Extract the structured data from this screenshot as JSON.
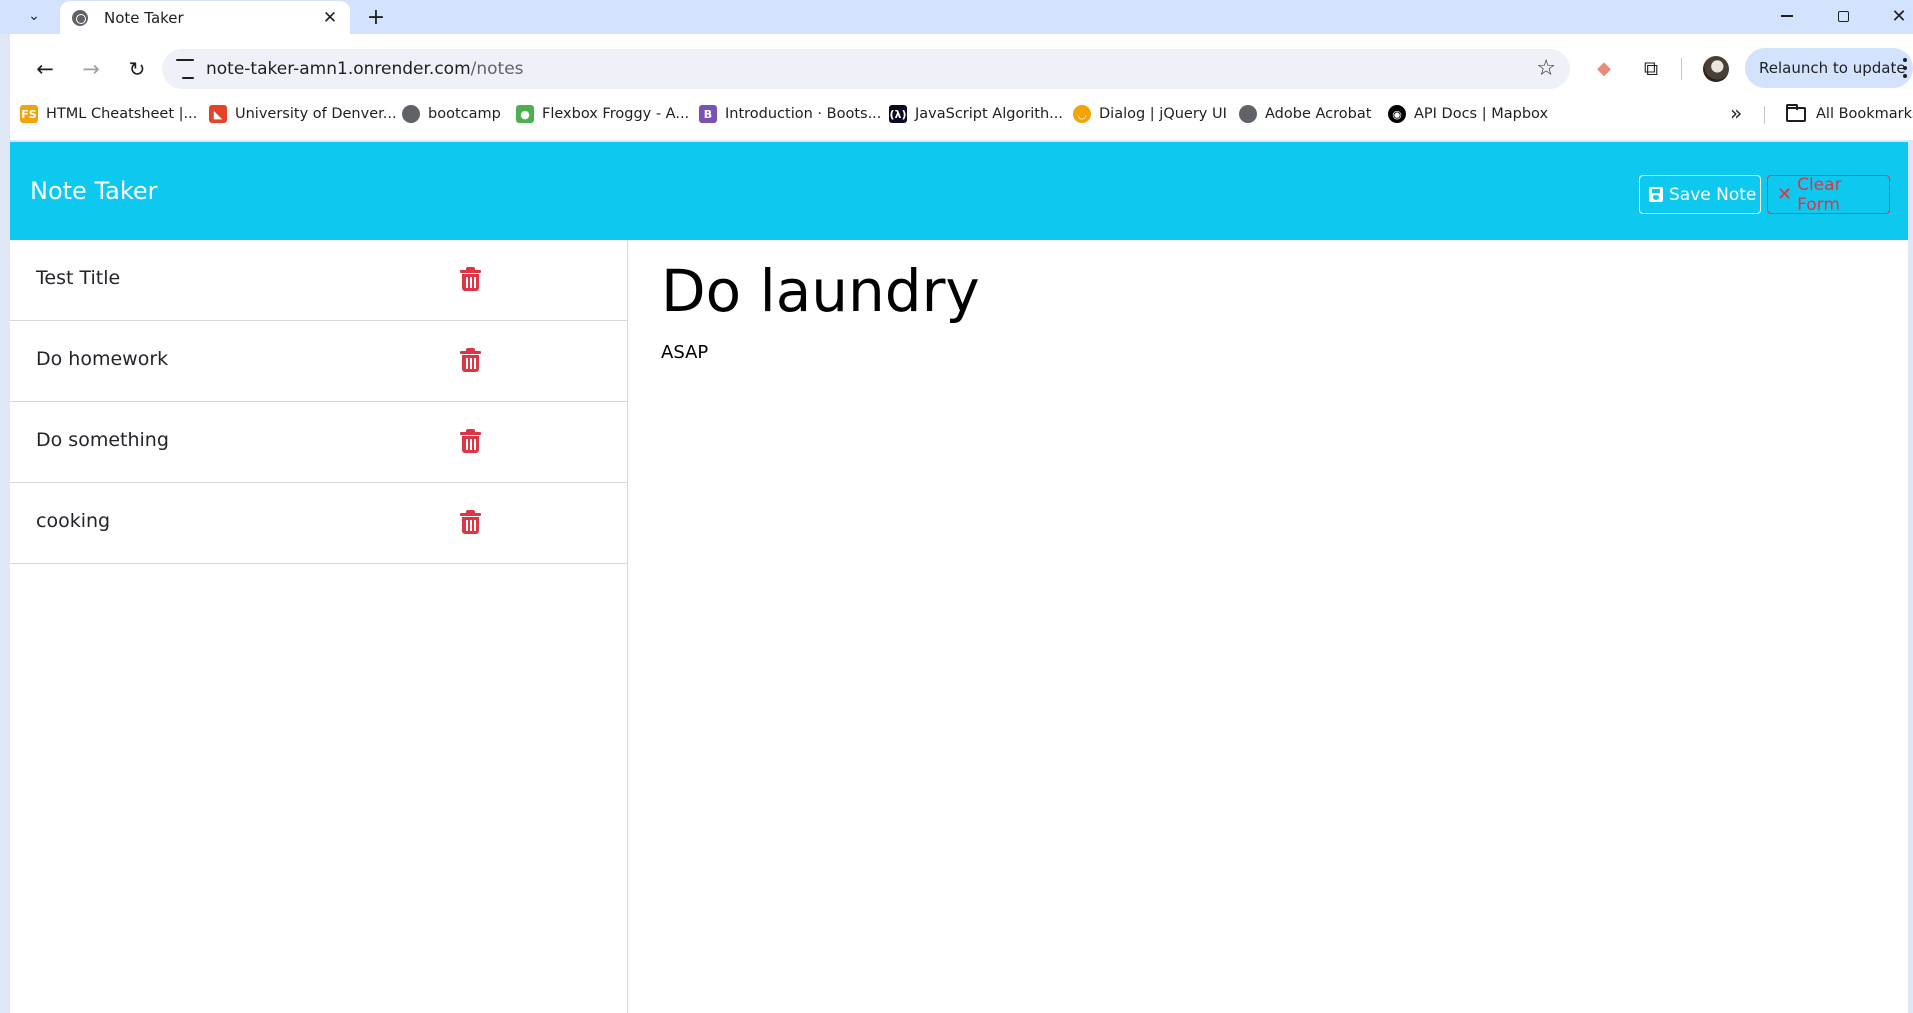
{
  "browser": {
    "tab": {
      "title": "Note Taker",
      "close_glyph": "✕"
    },
    "new_tab_glyph": "+",
    "window_close_glyph": "✕",
    "address": {
      "host": "note-taker-amn1.onrender.com",
      "path": "/notes"
    },
    "relaunch_label": "Relaunch to update",
    "bookmarks": [
      {
        "label": "HTML Cheatsheet |...",
        "icon": "fs-icon",
        "color": "#f0a30a"
      },
      {
        "label": "University of Denver...",
        "icon": "gitlab-icon",
        "color": "#e24329"
      },
      {
        "label": "bootcamp",
        "icon": "globe-icon",
        "color": "#5f6368"
      },
      {
        "label": "Flexbox Froggy - A...",
        "icon": "frog-icon",
        "color": "#4caf50"
      },
      {
        "label": "Introduction · Boots...",
        "icon": "bootstrap-icon",
        "color": "#7952b3"
      },
      {
        "label": "JavaScript Algorith...",
        "icon": "fcc-icon",
        "color": "#0a0a23"
      },
      {
        "label": "Dialog | jQuery UI",
        "icon": "jquery-icon",
        "color": "#f4a300"
      },
      {
        "label": "Adobe Acrobat",
        "icon": "globe-icon",
        "color": "#5f6368"
      },
      {
        "label": "API Docs | Mapbox",
        "icon": "mapbox-icon",
        "color": "#000000"
      }
    ],
    "all_bookmarks_label": "All Bookmarks"
  },
  "app": {
    "brand": "Note Taker",
    "save_label": "Save Note",
    "clear_label": "Clear Form",
    "notes": [
      {
        "title": "Test Title"
      },
      {
        "title": "Do homework"
      },
      {
        "title": "Do something"
      },
      {
        "title": "cooking"
      }
    ],
    "active_note": {
      "title": "Do laundry",
      "text": "ASAP"
    },
    "colors": {
      "navbar": "#0dc9ef",
      "danger": "#dc3545"
    }
  }
}
